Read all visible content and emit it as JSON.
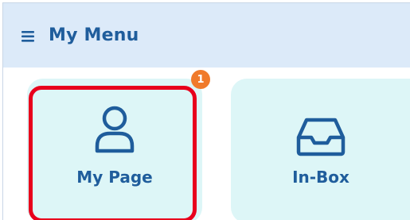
{
  "header": {
    "title": "My Menu",
    "icon": "hamburger-menu-icon"
  },
  "tiles": [
    {
      "label": "My Page",
      "icon": "person-icon",
      "badge": "1",
      "highlighted": true
    },
    {
      "label": "In-Box",
      "icon": "inbox-tray-icon"
    }
  ],
  "colors": {
    "header_bg": "#dceaf9",
    "tile_bg": "#ddf6f7",
    "text": "#1f5d9c",
    "highlight": "#e8001c",
    "badge": "#f07a2b"
  }
}
